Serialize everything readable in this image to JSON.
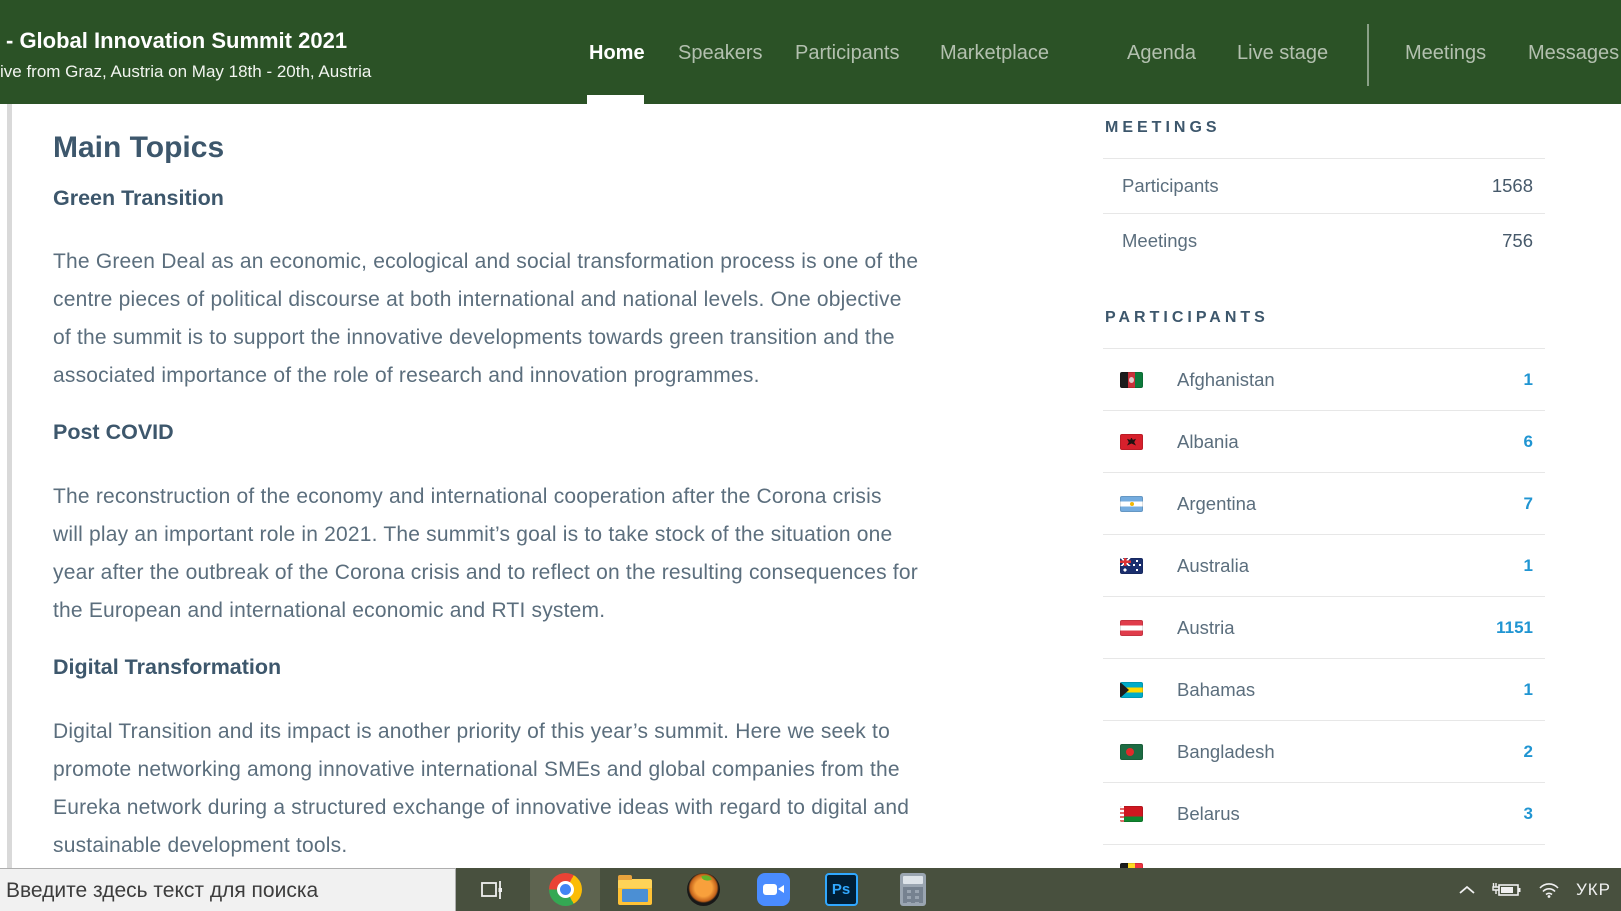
{
  "header": {
    "title": "- Global Innovation Summit 2021",
    "subtitle": "ive from Graz, Austria on May 18th - 20th, Austria",
    "nav": [
      {
        "label": "Home"
      },
      {
        "label": "Speakers"
      },
      {
        "label": "Participants"
      },
      {
        "label": "Marketplace"
      },
      {
        "label": "Agenda"
      },
      {
        "label": "Live stage"
      },
      {
        "label": "Meetings"
      },
      {
        "label": "Messages"
      }
    ]
  },
  "main": {
    "heading": "Main Topics",
    "sections": [
      {
        "title": "Green Transition",
        "lines": [
          "The Green Deal as an economic, ecological and social transformation process is one of the",
          "centre pieces of political discourse at both international and national levels. One objective",
          "of the summit is to support the innovative developments towards green transition and the",
          "associated importance of the role of research and innovation programmes."
        ]
      },
      {
        "title": "Post COVID",
        "lines": [
          "The reconstruction of the economy and international cooperation after the Corona crisis",
          "will play an important role in 2021. The summit’s goal is to take stock of the situation one",
          "year after the outbreak of the Corona crisis and to reflect on the resulting consequences for",
          "the European and international economic and RTI system."
        ]
      },
      {
        "title": "Digital Transformation",
        "lines": [
          "Digital Transition and its impact is another priority of this year’s summit. Here we seek to",
          "promote networking among innovative international SMEs and global companies from the",
          "Eureka network during a structured exchange of innovative ideas with regard to digital and",
          "sustainable development tools."
        ]
      }
    ]
  },
  "sidebar": {
    "meetings": {
      "title": "MEETINGS",
      "rows": [
        {
          "label": "Participants",
          "value": "1568"
        },
        {
          "label": "Meetings",
          "value": "756"
        }
      ]
    },
    "participants": {
      "title": "PARTICIPANTS",
      "rows": [
        {
          "country": "Afghanistan",
          "flag": "af",
          "count": "1"
        },
        {
          "country": "Albania",
          "flag": "al",
          "count": "6"
        },
        {
          "country": "Argentina",
          "flag": "ar",
          "count": "7"
        },
        {
          "country": "Australia",
          "flag": "au",
          "count": "1"
        },
        {
          "country": "Austria",
          "flag": "at",
          "count": "1151"
        },
        {
          "country": "Bahamas",
          "flag": "bs",
          "count": "1"
        },
        {
          "country": "Bangladesh",
          "flag": "bd",
          "count": "2"
        },
        {
          "country": "Belarus",
          "flag": "by",
          "count": "3"
        }
      ],
      "partial_flag": "be"
    }
  },
  "taskbar": {
    "search_placeholder": "Введите здесь текст для поиска",
    "apps": [
      "task-view",
      "chrome",
      "file-explorer",
      "fl-studio",
      "zoom",
      "photoshop",
      "calculator"
    ],
    "tray": {
      "language": "УКР"
    }
  },
  "colors": {
    "header_green": "#2b5226",
    "heading": "#3d576c",
    "body_text": "#5b6e7d",
    "count_blue": "#2095d2",
    "taskbar": "#48503e"
  }
}
